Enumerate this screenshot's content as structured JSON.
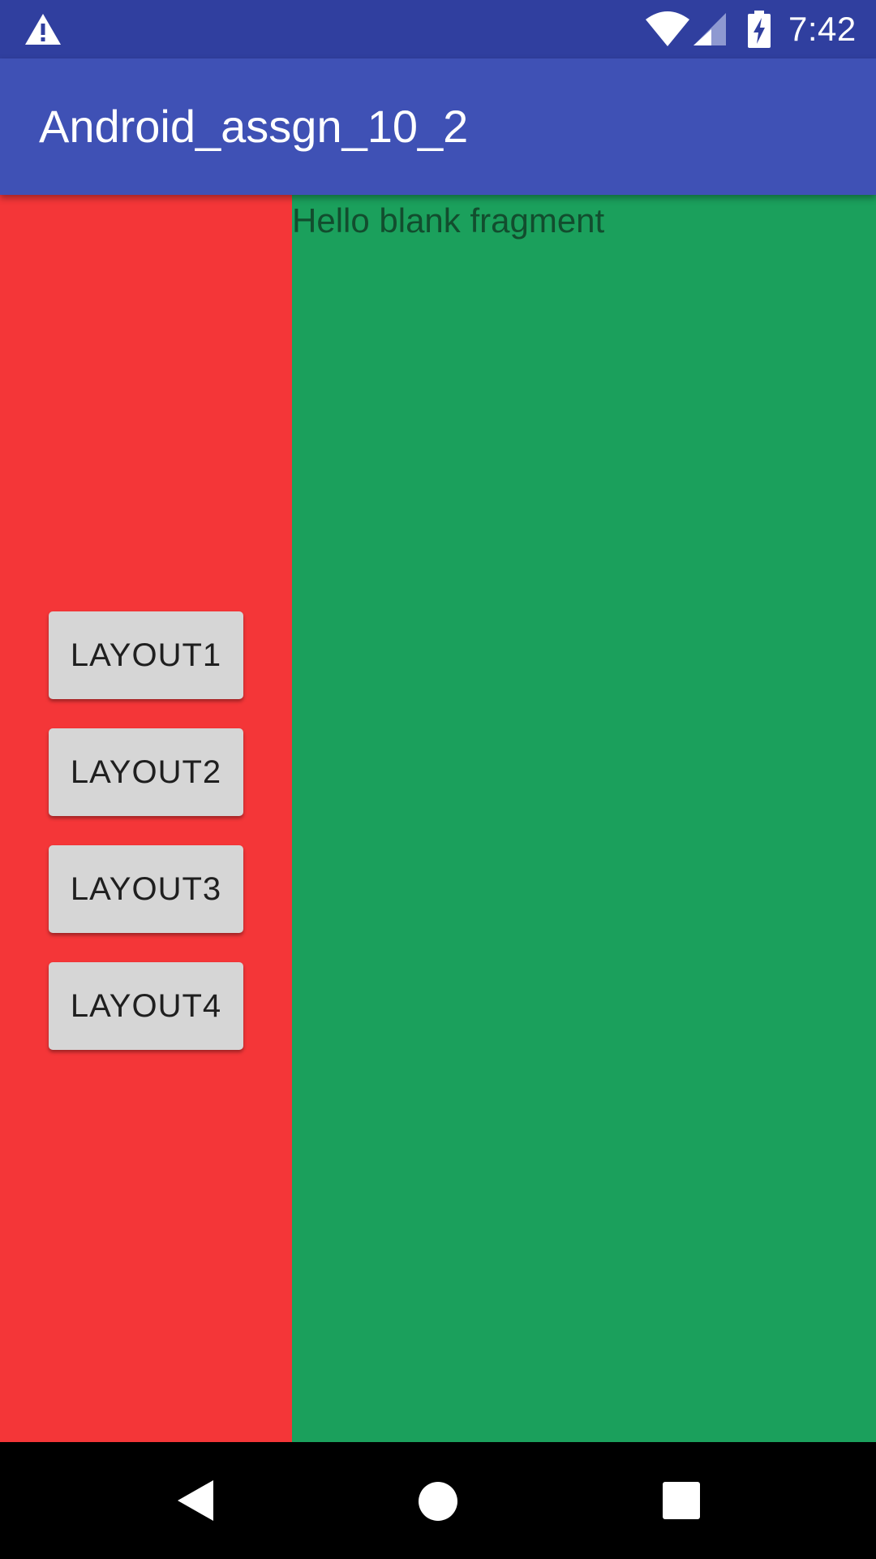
{
  "status_bar": {
    "time": "7:42",
    "icons": [
      "warning-icon",
      "wifi-icon",
      "cell-signal-icon",
      "battery-charging-icon"
    ],
    "background": "#303F9F"
  },
  "app_bar": {
    "title": "Android_assgn_10_2",
    "background": "#3F51B5"
  },
  "left_fragment": {
    "background": "#F43638",
    "buttons": [
      {
        "label": "LAYOUT1"
      },
      {
        "label": "LAYOUT2"
      },
      {
        "label": "LAYOUT3"
      },
      {
        "label": "LAYOUT4"
      }
    ]
  },
  "right_fragment": {
    "background": "#1BA05C",
    "text": "Hello blank fragment"
  },
  "nav_bar": {
    "icons": [
      "back-icon",
      "home-icon",
      "recents-icon"
    ]
  }
}
